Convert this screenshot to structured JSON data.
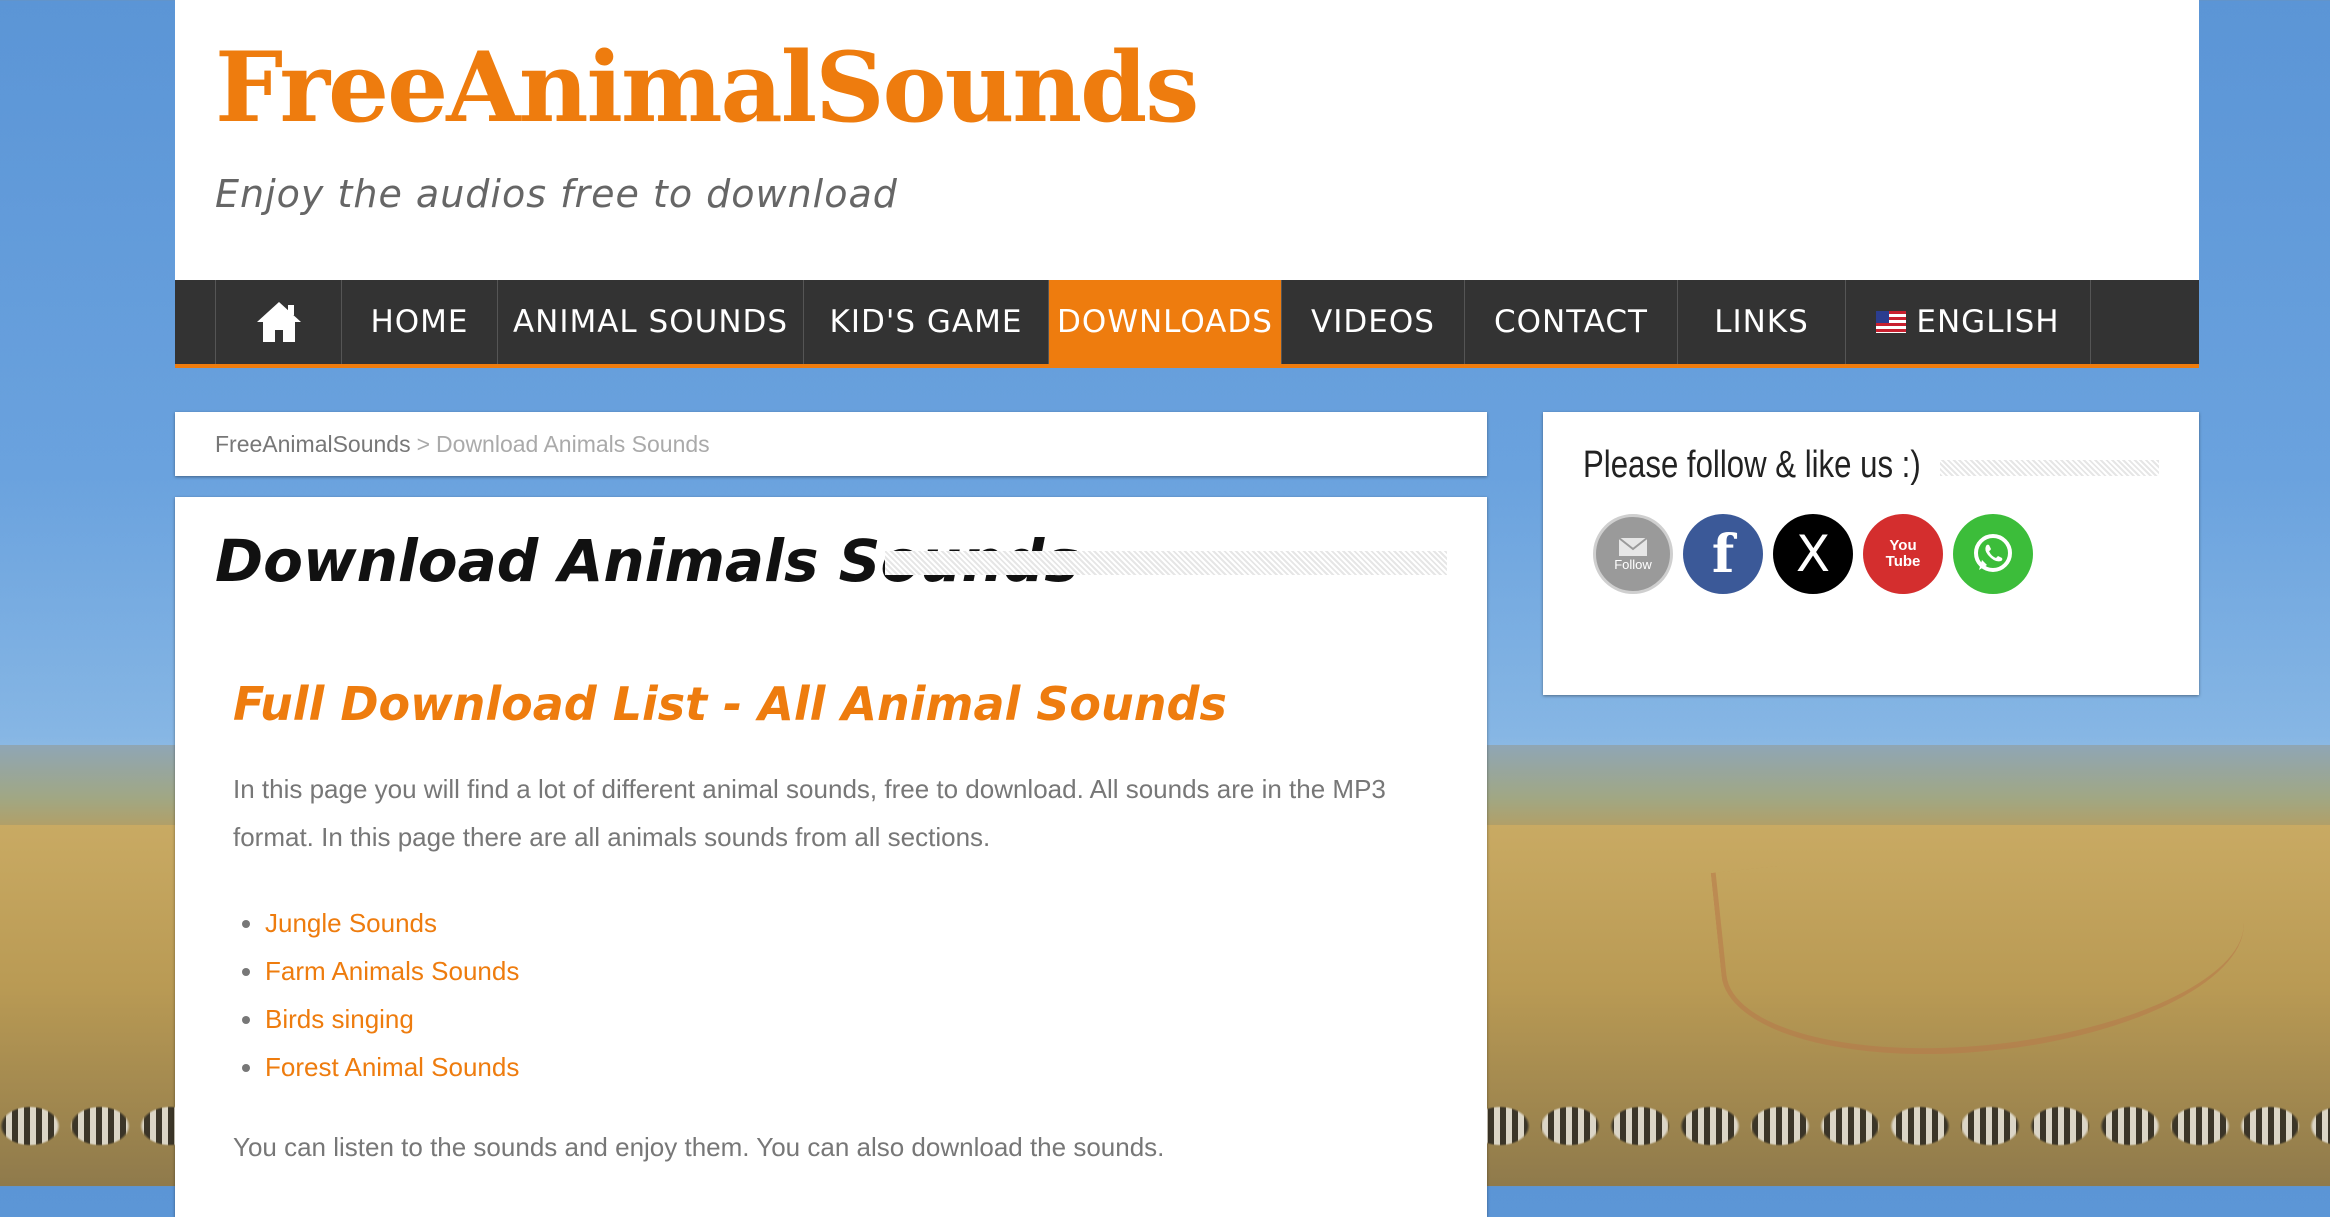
{
  "site": {
    "logo": "FreeAnimalSounds",
    "tagline": "Enjoy the audios free to download"
  },
  "nav": {
    "home_icon": "home-icon",
    "items": [
      {
        "label": "HOME"
      },
      {
        "label": "ANIMAL SOUNDS"
      },
      {
        "label": "KID'S GAME"
      },
      {
        "label": "DOWNLOADS",
        "active": true
      },
      {
        "label": "VIDEOS"
      },
      {
        "label": "CONTACT"
      },
      {
        "label": "LINKS"
      },
      {
        "label": "ENGLISH",
        "icon": "us-flag-icon"
      }
    ]
  },
  "breadcrumb": {
    "home": "FreeAnimalSounds",
    "separator": ">",
    "current": "Download Animals Sounds"
  },
  "main": {
    "title": "Download Animals Sounds",
    "subtitle": "Full Download List - All Animal Sounds",
    "intro": "In this page you will find a lot of different animal sounds, free to download. All sounds are in the MP3 format. In this page there are all animals sounds from all sections.",
    "links": [
      "Jungle Sounds",
      "Farm Animals Sounds",
      "Birds singing",
      "Forest Animal Sounds"
    ],
    "outro": "You can listen to the sounds and enjoy them. You can also download the sounds."
  },
  "sidebar": {
    "title": "Please follow & like us :)",
    "social": [
      {
        "name": "email-follow-icon",
        "label": "Follow"
      },
      {
        "name": "facebook-icon",
        "label": "f"
      },
      {
        "name": "x-icon",
        "label": "X"
      },
      {
        "name": "youtube-icon",
        "label": "You Tube"
      },
      {
        "name": "whatsapp-icon",
        "label": ""
      }
    ]
  },
  "colors": {
    "accent": "#ee7c0e",
    "nav_bg": "#333333",
    "text": "#777777"
  }
}
